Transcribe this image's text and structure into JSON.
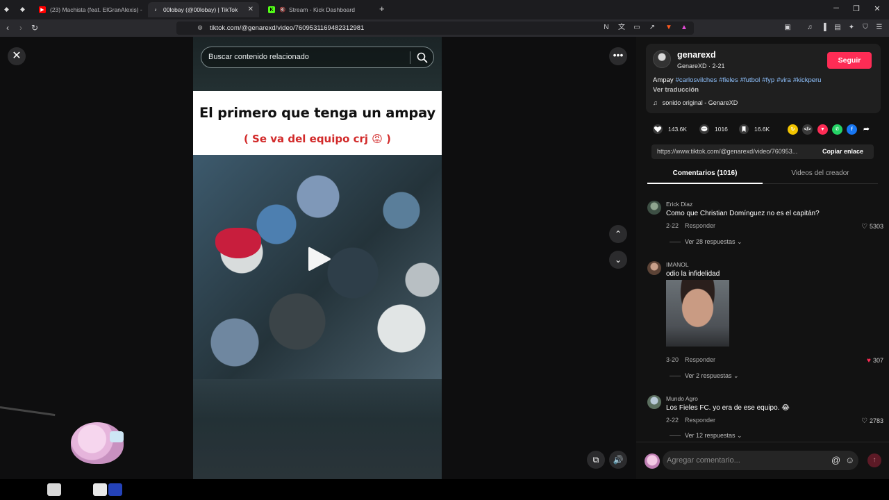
{
  "browser": {
    "tabs": [
      {
        "title": "(23) Machista (feat. ElGranAlexis) - Y",
        "active": false
      },
      {
        "title": "00lobay (@00lobay) | TikTok",
        "active": true
      },
      {
        "title": "Stream - Kick Dashboard",
        "active": false
      }
    ],
    "new_tab": "+",
    "url": "tiktok.com/@genarexd/video/7609531169482312981"
  },
  "video": {
    "search_placeholder": "Buscar contenido relacionado",
    "caption_title": "El primero que tenga un ampay",
    "caption_subtitle": "( Se va del equipo crj 😡 )"
  },
  "author": {
    "name": "genarexd",
    "subtitle": "GenareXD · 2-21",
    "follow_label": "Seguir",
    "description_lead": "Ampay",
    "hashtags": [
      "#carlosvilches",
      "#fieles",
      "#futbol",
      "#fyp",
      "#vira",
      "#kickperu"
    ],
    "translate_label": "Ver traducción",
    "sound": "sonido original - GenareXD"
  },
  "stats": {
    "likes": "143.6K",
    "comments": "1016",
    "saves": "16.6K"
  },
  "share": {
    "link": "https://www.tiktok.com/@genarexd/video/760953...",
    "copy_label": "Copiar enlace"
  },
  "panel_tabs": {
    "comments": "Comentarios (1016)",
    "creator_videos": "Videos del creador"
  },
  "comments": [
    {
      "user": "Erick Diaz",
      "text": "Como que Christian Domínguez no es el capitán?",
      "date": "2-22",
      "reply": "Responder",
      "likes": "5303",
      "liked": false,
      "more": "Ver 28 respuestas ⌄"
    },
    {
      "user": "IMANOL",
      "text": "odio la infidelidad",
      "date": "3-20",
      "reply": "Responder",
      "likes": "307",
      "liked": true,
      "more": "Ver 2 respuestas ⌄"
    },
    {
      "user": "Mundo Agro",
      "text": "Los Fieles FC. yo era de ese equipo. 😂",
      "date": "2-22",
      "reply": "Responder",
      "likes": "2783",
      "liked": false,
      "more": "Ver 12 respuestas ⌄"
    }
  ],
  "comment_input": {
    "placeholder": "Agregar comentario..."
  },
  "colors": {
    "accent": "#fe2c55",
    "hashtag": "#8fc2ff"
  }
}
